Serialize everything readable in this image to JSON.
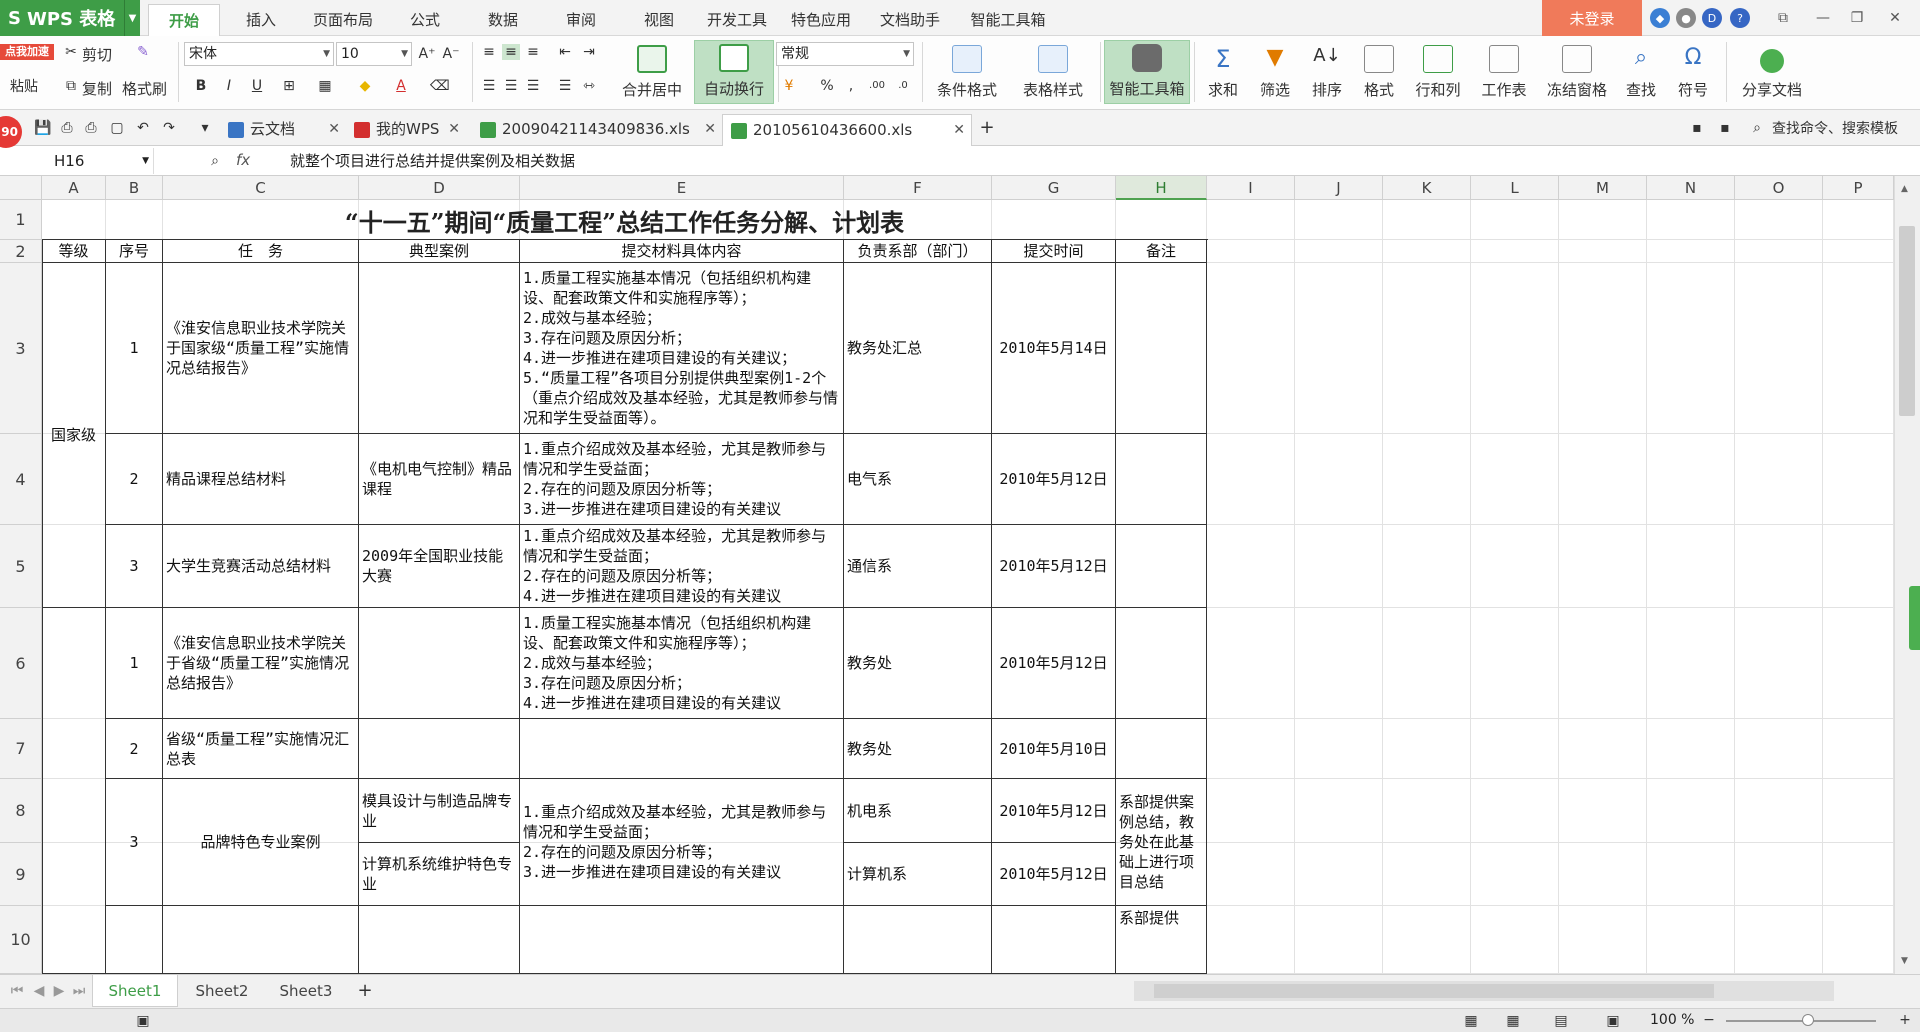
{
  "app": {
    "name": "WPS 表格",
    "login_label": "未登录"
  },
  "ribbon_tabs": [
    "开始",
    "插入",
    "页面布局",
    "公式",
    "数据",
    "审阅",
    "视图",
    "开发工具",
    "特色应用",
    "文档助手",
    "智能工具箱"
  ],
  "ribbon": {
    "cut": "剪切",
    "copy": "复制",
    "format_painter": "格式刷",
    "paste": "粘贴",
    "font_name": "宋体",
    "font_size": "10",
    "merge_center": "合并居中",
    "wrap_text": "自动换行",
    "number_format": "常规",
    "conditional_format": "条件格式",
    "table_style": "表格样式",
    "smart_toolbox": "智能工具箱",
    "sum": "求和",
    "filter": "筛选",
    "sort": "排序",
    "format": "格式",
    "row_col": "行和列",
    "worksheet": "工作表",
    "freeze": "冻结窗格",
    "find": "查找",
    "symbol": "符号",
    "share": "分享文档",
    "promo_label": "点我加速",
    "badge": "90"
  },
  "doc_tabs": [
    {
      "label": "云文档"
    },
    {
      "label": "我的WPS"
    },
    {
      "label": "20090421143409836.xls"
    },
    {
      "label": "20105610436600.xls"
    }
  ],
  "search_hint": "查找命令、搜索模板",
  "formula_bar": {
    "cell_ref": "H16",
    "fx": "fx",
    "content": "就整个项目进行总结并提供案例及相关数据"
  },
  "columns": [
    "A",
    "B",
    "C",
    "D",
    "E",
    "F",
    "G",
    "H",
    "I",
    "J",
    "K",
    "L",
    "M",
    "N",
    "O",
    "P"
  ],
  "rows": [
    "1",
    "2",
    "3",
    "4",
    "5",
    "6",
    "7",
    "8",
    "9",
    "10"
  ],
  "sheet": {
    "title": "“十一五”期间“质量工程”总结工作任务分解、计划表",
    "headers": [
      "等级",
      "序号",
      "任　务",
      "典型案例",
      "提交材料具体内容",
      "负责系部（部门）",
      "提交时间",
      "备注"
    ],
    "level_national": "国家级",
    "r3": {
      "no": "1",
      "task": "《淮安信息职业技术学院关于国家级“质量工程”实施情况总结报告》",
      "case": "",
      "content": "1.质量工程实施基本情况（包括组织机构建设、配套政策文件和实施程序等）；\n2.成效与基本经验；\n3.存在问题及原因分析；\n4.进一步推进在建项目建设的有关建议；\n5.“质量工程”各项目分别提供典型案例1-2个（重点介绍成效及基本经验，尤其是教师参与情况和学生受益面等）。",
      "dept": "教务处汇总",
      "date": "2010年5月14日",
      "note": ""
    },
    "r4": {
      "no": "2",
      "task": "精品课程总结材料",
      "case": "《电机电气控制》精品课程",
      "content": "1.重点介绍成效及基本经验，尤其是教师参与情况和学生受益面；\n2.存在的问题及原因分析等；\n3.进一步推进在建项目建设的有关建议",
      "dept": "电气系",
      "date": "2010年5月12日",
      "note": ""
    },
    "r5": {
      "no": "3",
      "task": "大学生竞赛活动总结材料",
      "case": "2009年全国职业技能大赛",
      "content": "1.重点介绍成效及基本经验，尤其是教师参与情况和学生受益面；\n2.存在的问题及原因分析等；\n4.进一步推进在建项目建设的有关建议",
      "dept": "通信系",
      "date": "2010年5月12日",
      "note": ""
    },
    "r6": {
      "no": "1",
      "task": "《淮安信息职业技术学院关于省级“质量工程”实施情况总结报告》",
      "case": "",
      "content": "1.质量工程实施基本情况（包括组织机构建设、配套政策文件和实施程序等）；\n2.成效与基本经验；\n3.存在问题及原因分析；\n4.进一步推进在建项目建设的有关建议",
      "dept": "教务处",
      "date": "2010年5月12日",
      "note": ""
    },
    "r7": {
      "no": "2",
      "task": "省级“质量工程”实施情况汇总表",
      "case": "",
      "content": "",
      "dept": "教务处",
      "date": "2010年5月10日",
      "note": ""
    },
    "r8": {
      "no": "3",
      "task": "品牌特色专业案例",
      "case": "模具设计与制造品牌专业",
      "content": "1.重点介绍成效及基本经验，尤其是教师参与情况和学生受益面；\n2.存在的问题及原因分析等；\n3.进一步推进在建项目建设的有关建议",
      "dept": "机电系",
      "date": "2010年5月12日",
      "note": "系部提供案例总结，教务处在此基础上进行项目总结"
    },
    "r9": {
      "case": "计算机系统维护特色专业",
      "dept": "计算机系",
      "date": "2010年5月12日"
    },
    "r10": {
      "note": "系部提供"
    }
  },
  "sheet_tabs": [
    "Sheet1",
    "Sheet2",
    "Sheet3"
  ],
  "status": {
    "zoom": "100 %"
  }
}
